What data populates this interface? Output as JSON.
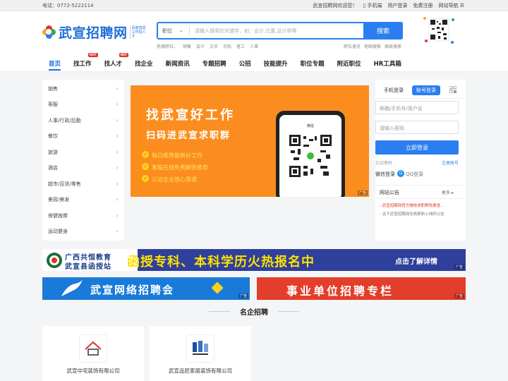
{
  "topbar": {
    "phone": "电话：0772-5222114",
    "welcome": "武宣招聘网欢迎您！",
    "mobile": "手机端",
    "user_login": "用户登录",
    "free_register": "免费注册",
    "site_nav": "网站导航"
  },
  "header": {
    "logo_text": "武宣招聘网",
    "slogan": "百度直招工作找人才",
    "search": {
      "type": "职位",
      "placeholder": "请输入搜索的关键字，如：会计,位置,设计师等"
    },
    "search_button": "搜索",
    "hot_label": "热搜职位：",
    "hot_items": [
      "销售",
      "会计",
      "文员",
      "司机",
      "普工",
      "人事"
    ],
    "links": [
      "职位速览",
      "地图搜索",
      "高级搜索"
    ]
  },
  "nav": [
    {
      "label": "首页",
      "hot": ""
    },
    {
      "label": "找工作",
      "hot": "HOT"
    },
    {
      "label": "找人才",
      "hot": "HOT"
    },
    {
      "label": "找企业",
      "hot": ""
    },
    {
      "label": "新闻资讯",
      "hot": ""
    },
    {
      "label": "专题招聘",
      "hot": ""
    },
    {
      "label": "公招",
      "hot": ""
    },
    {
      "label": "技能提升",
      "hot": ""
    },
    {
      "label": "职位专题",
      "hot": ""
    },
    {
      "label": "附近职位",
      "hot": ""
    },
    {
      "label": "HR工具箱",
      "hot": ""
    }
  ],
  "categories": [
    "销售",
    "客服",
    "人事/行政/后勤",
    "餐饮",
    "旅游",
    "酒店",
    "超市/百货/零售",
    "美容/美发",
    "保健按摩",
    "运动健身"
  ],
  "banner": {
    "title": "找武宣好工作",
    "subtitle": "扫码进武宣求职群",
    "points": [
      "每日推荐最新好工作",
      "客服在线免费解答推荐",
      "认证企业放心靠谱"
    ],
    "phone_header": "微信",
    "ad": "广告"
  },
  "login": {
    "tab_mobile": "手机登录",
    "tab_account": "账号登录",
    "account_placeholder": "邮箱/手机号/用户名",
    "password_placeholder": "请输入密码",
    "login_button": "立即登录",
    "forgot": "忘记密码",
    "register": "注册账号",
    "wechat": "微信登录",
    "qq": "QQ登录"
  },
  "notice": {
    "title": "网站公告",
    "more": "更多",
    "items": [
      "武宣招聘网官方微信求职群免费进…",
      "关于武宣招聘网全面更新上线的公告"
    ]
  },
  "ads": {
    "ad1_left": "广西共恒教育",
    "ad1_left2": "武宣县函授站",
    "ad1_main": "函授专科、本科学历火热报名中",
    "ad1_right": "点击了解详情",
    "ad2_text": "武宣网络招聘会",
    "ad3_text": "事业单位招聘专栏",
    "ad_tag": "广告"
  },
  "section_title": "名企招聘",
  "companies": [
    "武宣中宅装饰有限公司",
    "武宣品匠家居装饰有限公司"
  ],
  "colors": {
    "primary": "#2b7ef0",
    "banner": "#fb8d1e",
    "hot": "#e2322b"
  }
}
